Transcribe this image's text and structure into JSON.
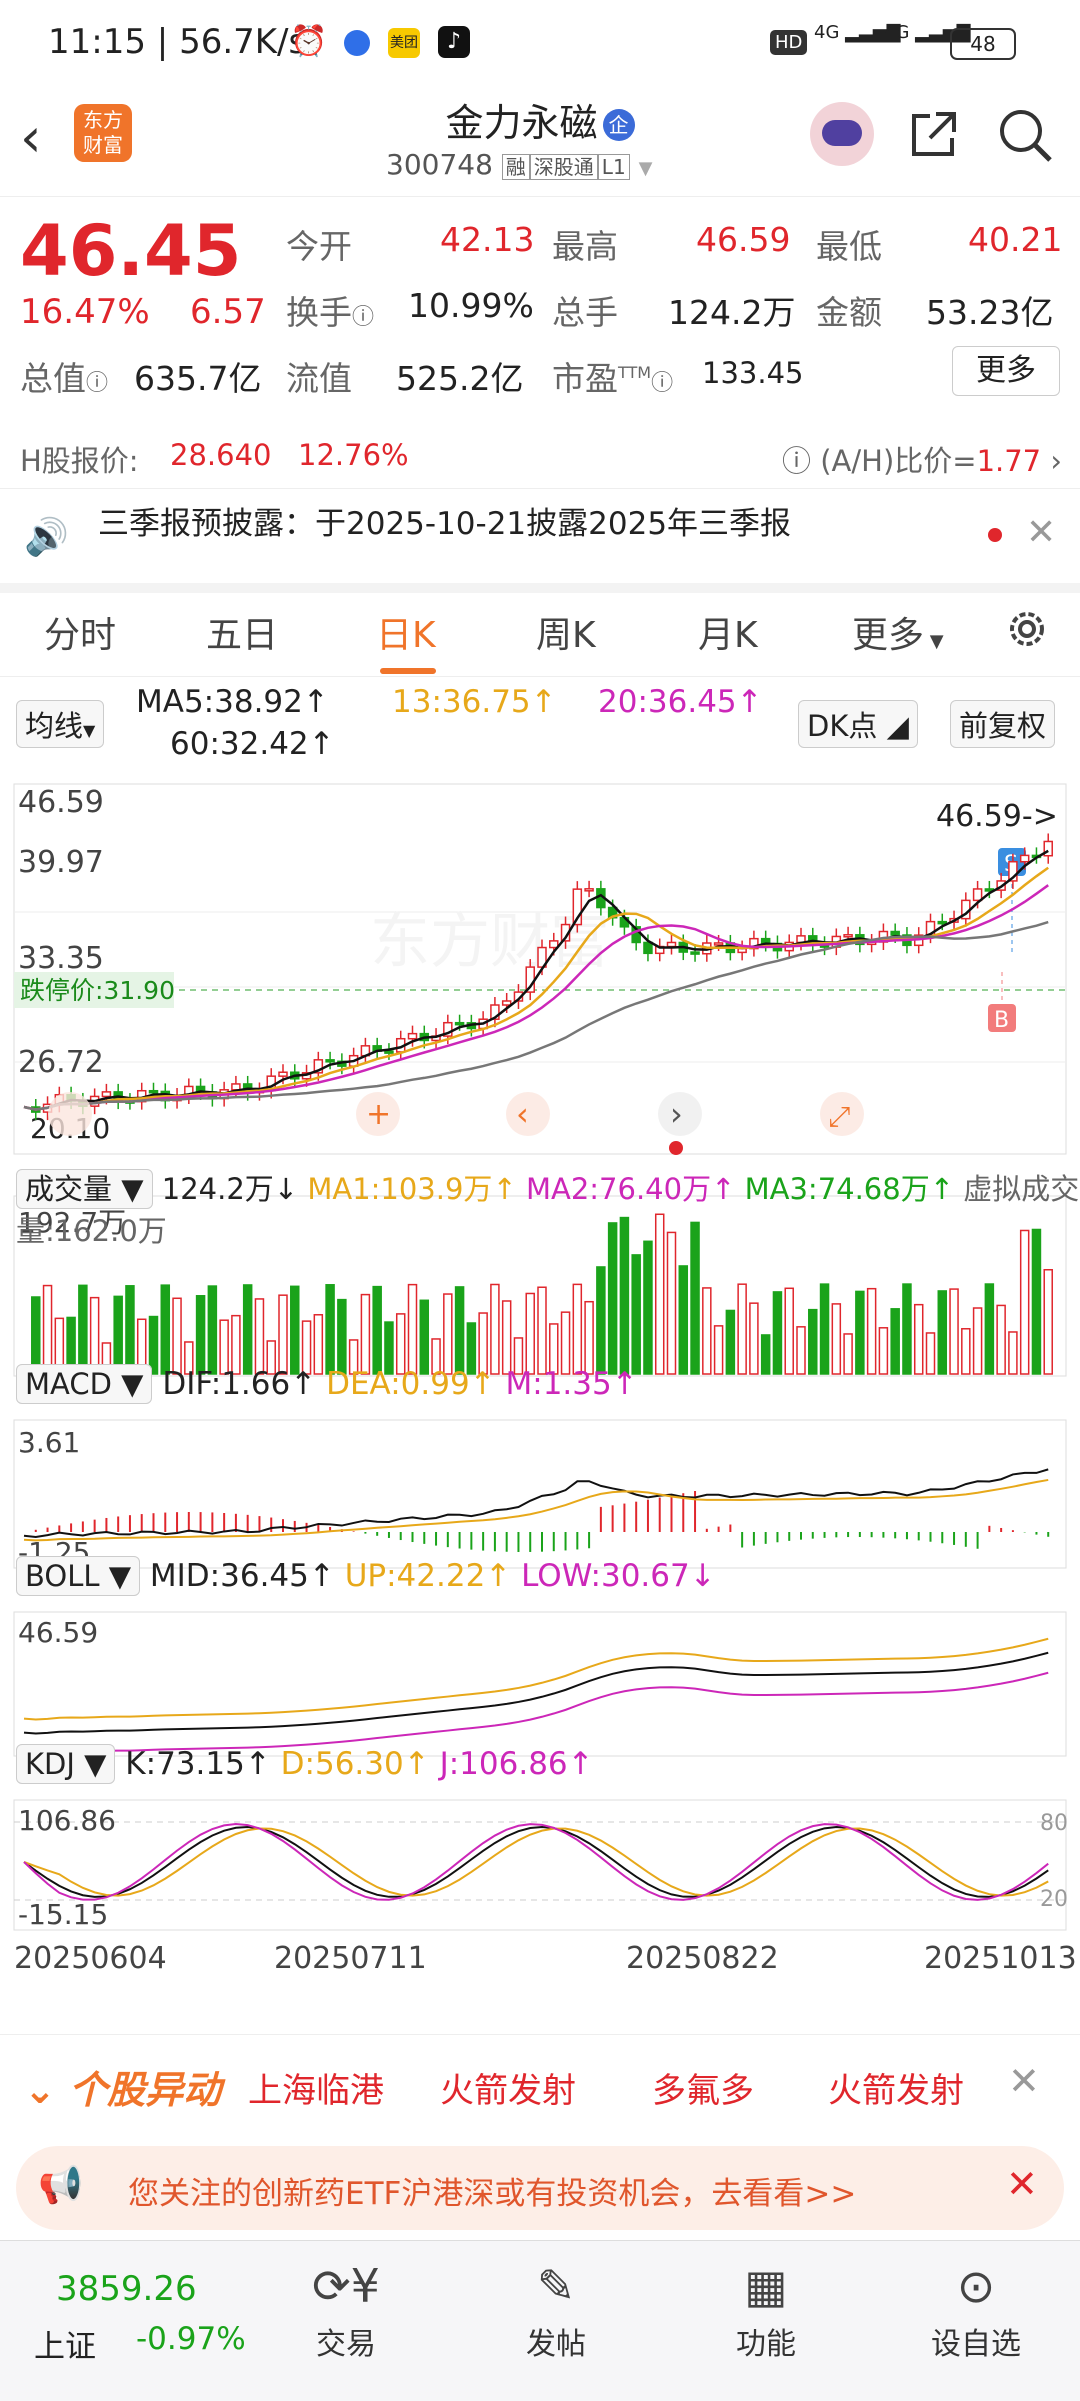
{
  "status_bar": {
    "time": "11:15",
    "speed": "56.7K/s",
    "hd": "HD",
    "net1": "4G",
    "net2": "4G",
    "battery": "48"
  },
  "header": {
    "logo_text": "东方财富",
    "title": "金力永磁",
    "badge": "企",
    "code": "300748",
    "tags": [
      "融",
      "深股通",
      "L1"
    ]
  },
  "quote": {
    "price": "46.45",
    "change_pct": "16.47%",
    "change": "6.57",
    "open_label": "今开",
    "open": "42.13",
    "high_label": "最高",
    "high": "46.59",
    "low_label": "最低",
    "low": "40.21",
    "turnover_label": "换手",
    "turnover": "10.99%",
    "volume_label": "总手",
    "volume": "124.2万",
    "amount_label": "金额",
    "amount": "53.23亿",
    "mktcap_label": "总值",
    "mktcap": "635.7亿",
    "float_label": "流值",
    "float": "525.2亿",
    "pe_label": "市盈",
    "pe_sup": "TTM",
    "pe": "133.45",
    "more_label": "更多"
  },
  "hshare": {
    "label": "H股报价:",
    "price": "28.640",
    "pct": "12.76%",
    "ah_label": "(A/H)比价=",
    "ah": "1.77"
  },
  "notice": {
    "text": "三季报预披露：于2025-10-21披露2025年三季报"
  },
  "tabs": [
    "分时",
    "五日",
    "日K",
    "周K",
    "月K",
    "更多"
  ],
  "active_tab": "日K",
  "kline": {
    "ma_toggle": "均线",
    "ma5": "MA5:38.92",
    "ma13": "13:36.75",
    "ma20": "20:36.45",
    "ma60": "60:32.42",
    "dk_label": "DK点",
    "fq_label": "前复权",
    "y_labels": [
      "46.59",
      "39.97",
      "33.35",
      "26.72"
    ],
    "limit_down": "跌停价:31.90",
    "max_label": "46.59->",
    "min_label": "20.10",
    "s_label": "S",
    "b_label": "B"
  },
  "volume": {
    "toggle": "成交量",
    "value": "124.2万",
    "ma1": "MA1:103.9万",
    "ma2": "MA2:76.40万",
    "ma3": "MA3:74.68万",
    "virtual": "虚拟成交量:162.0万",
    "max": "192.7万"
  },
  "macd": {
    "toggle": "MACD",
    "dif": "DIF:1.66",
    "dea": "DEA:0.99",
    "m": "M:1.35",
    "top": "3.61",
    "bottom": "-1.25"
  },
  "boll": {
    "toggle": "BOLL",
    "mid": "MID:36.45",
    "up": "UP:42.22",
    "low": "LOW:30.67",
    "top": "46.59"
  },
  "kdj": {
    "toggle": "KDJ",
    "k": "K:73.15",
    "d": "D:56.30",
    "j": "J:106.86",
    "top": "106.86",
    "bottom": "-15.15",
    "l80": "80",
    "l20": "20"
  },
  "dates": [
    "20250604",
    "20250711",
    "20250822",
    "20251013"
  ],
  "movers": {
    "title": "个股异动",
    "items": [
      "上海临港",
      "火箭发射",
      "多氟多",
      "火箭发射"
    ]
  },
  "banner": {
    "text": "您关注的创新药ETF沪港深或有投资机会，去看看>>"
  },
  "bottom": {
    "index_value": "3859.26",
    "index_name": "上证",
    "index_pct": "-0.97%",
    "nav": [
      "交易",
      "发帖",
      "功能",
      "设自选"
    ]
  },
  "colors": {
    "up": "#e0262c",
    "down": "#1aa31a",
    "accent": "#f0742a",
    "ma13": "#e7a81a",
    "ma20": "#cc27b8"
  }
}
